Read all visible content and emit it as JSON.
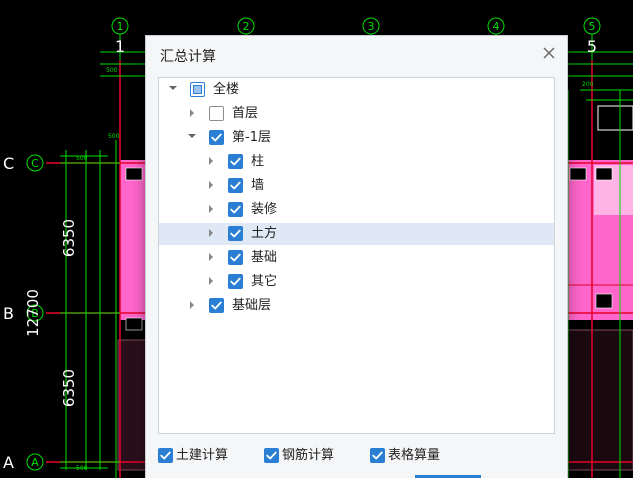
{
  "cad": {
    "axis_top": [
      "1",
      "2",
      "3",
      "4",
      "5"
    ],
    "axis_left": [
      "C",
      "B",
      "A"
    ],
    "dims": {
      "upper": "6350",
      "lower": "6350",
      "total": "12700"
    },
    "colors": {
      "bg": "#000000",
      "grid": "#00e000",
      "axis_red": "#e8002a",
      "fill_pink": "#ff66cc"
    }
  },
  "dialog": {
    "title": "汇总计算",
    "tree": [
      {
        "label": "全楼",
        "state": "partial",
        "expandable": true,
        "expanded": true,
        "selected": false
      },
      {
        "label": "首层",
        "state": "unchecked",
        "expandable": true,
        "expanded": false,
        "selected": false
      },
      {
        "label": "第-1层",
        "state": "checked",
        "expandable": true,
        "expanded": true,
        "selected": false
      },
      {
        "label": "柱",
        "state": "checked",
        "expandable": true,
        "expanded": false,
        "selected": false
      },
      {
        "label": "墙",
        "state": "checked",
        "expandable": true,
        "expanded": false,
        "selected": false
      },
      {
        "label": "装修",
        "state": "checked",
        "expandable": true,
        "expanded": false,
        "selected": false
      },
      {
        "label": "土方",
        "state": "checked",
        "expandable": true,
        "expanded": false,
        "selected": true
      },
      {
        "label": "基础",
        "state": "checked",
        "expandable": true,
        "expanded": false,
        "selected": false
      },
      {
        "label": "其它",
        "state": "checked",
        "expandable": true,
        "expanded": false,
        "selected": false
      },
      {
        "label": "基础层",
        "state": "checked",
        "expandable": true,
        "expanded": false,
        "selected": false
      }
    ],
    "options": [
      {
        "label": "土建计算",
        "checked": true
      },
      {
        "label": "钢筋计算",
        "checked": true
      },
      {
        "label": "表格算量",
        "checked": true
      }
    ]
  }
}
